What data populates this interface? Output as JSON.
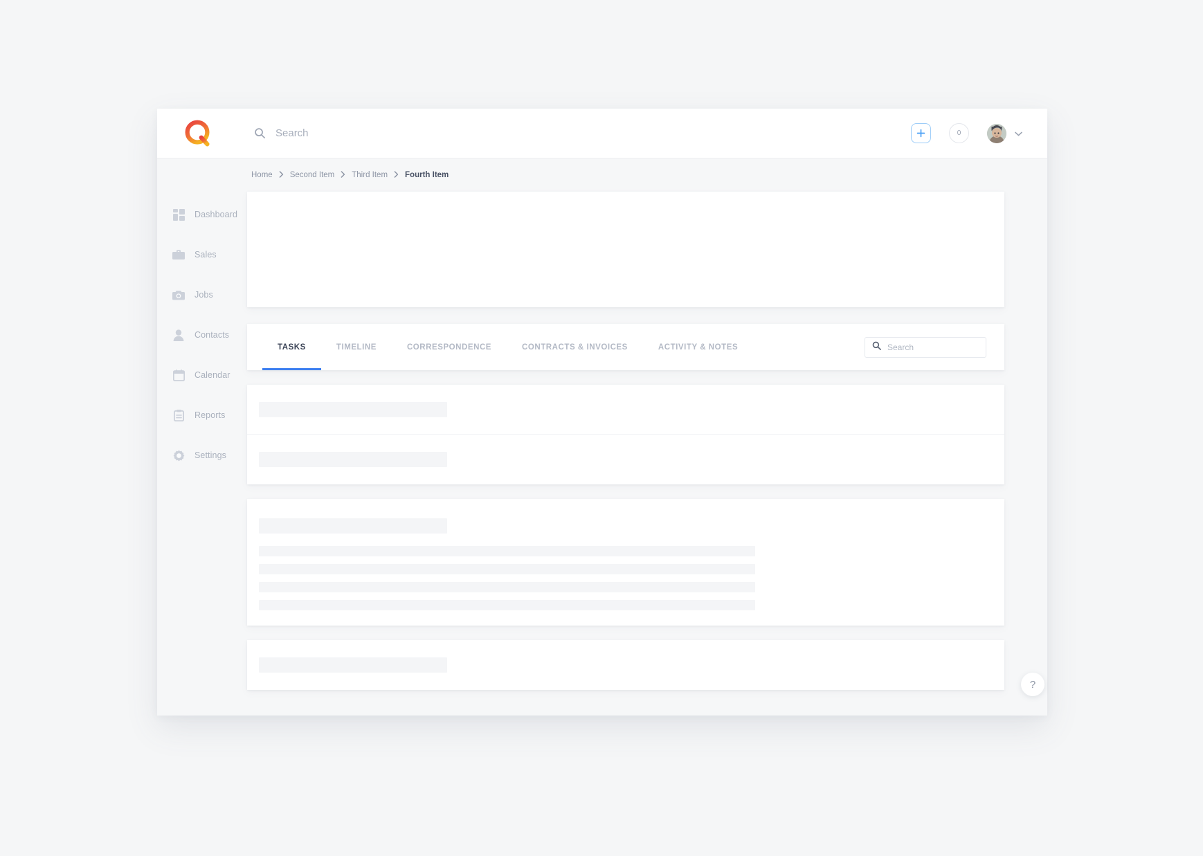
{
  "colors": {
    "accent_blue": "#3c7ef0",
    "add_button_border": "#9ecdf8",
    "logo_red": "#e8413f",
    "logo_orange": "#f5a623",
    "page_background": "#f5f6f7",
    "card_background": "#ffffff",
    "skeleton_gray": "#f4f5f7",
    "muted_text": "#aab1bd"
  },
  "header": {
    "logo_name": "q-logo-icon",
    "search": {
      "icon": "search-icon",
      "placeholder": "Search",
      "value": ""
    },
    "add_button": {
      "icon": "plus-icon",
      "label": ""
    },
    "notifications": {
      "icon": "notification-count-badge",
      "count": "0"
    },
    "profile": {
      "avatar_name": "avatar",
      "caret_icon": "chevron-down-icon"
    }
  },
  "sidebar": {
    "items": [
      {
        "label": "Dashboard",
        "icon": "dashboard-icon"
      },
      {
        "label": "Sales",
        "icon": "briefcase-icon"
      },
      {
        "label": "Jobs",
        "icon": "camera-icon"
      },
      {
        "label": "Contacts",
        "icon": "person-icon"
      },
      {
        "label": "Calendar",
        "icon": "calendar-icon"
      },
      {
        "label": "Reports",
        "icon": "clipboard-icon"
      },
      {
        "label": "Settings",
        "icon": "gear-icon"
      }
    ]
  },
  "breadcrumb": {
    "separator": "›",
    "items": [
      {
        "label": "Home",
        "current": false
      },
      {
        "label": "Second Item",
        "current": false
      },
      {
        "label": "Third Item",
        "current": false
      },
      {
        "label": "Fourth Item",
        "current": true
      }
    ]
  },
  "main": {
    "tabs": [
      {
        "label": "TASKS",
        "active": true
      },
      {
        "label": "TIMELINE",
        "active": false
      },
      {
        "label": "CORRESPONDENCE",
        "active": false
      },
      {
        "label": "CONTRACTS & INVOICES",
        "active": false
      },
      {
        "label": "ACTIVITY & NOTES",
        "active": false
      }
    ],
    "tab_search": {
      "icon": "search-icon",
      "placeholder": "Search",
      "value": ""
    }
  },
  "help": {
    "label": "?",
    "icon": "help-icon"
  }
}
